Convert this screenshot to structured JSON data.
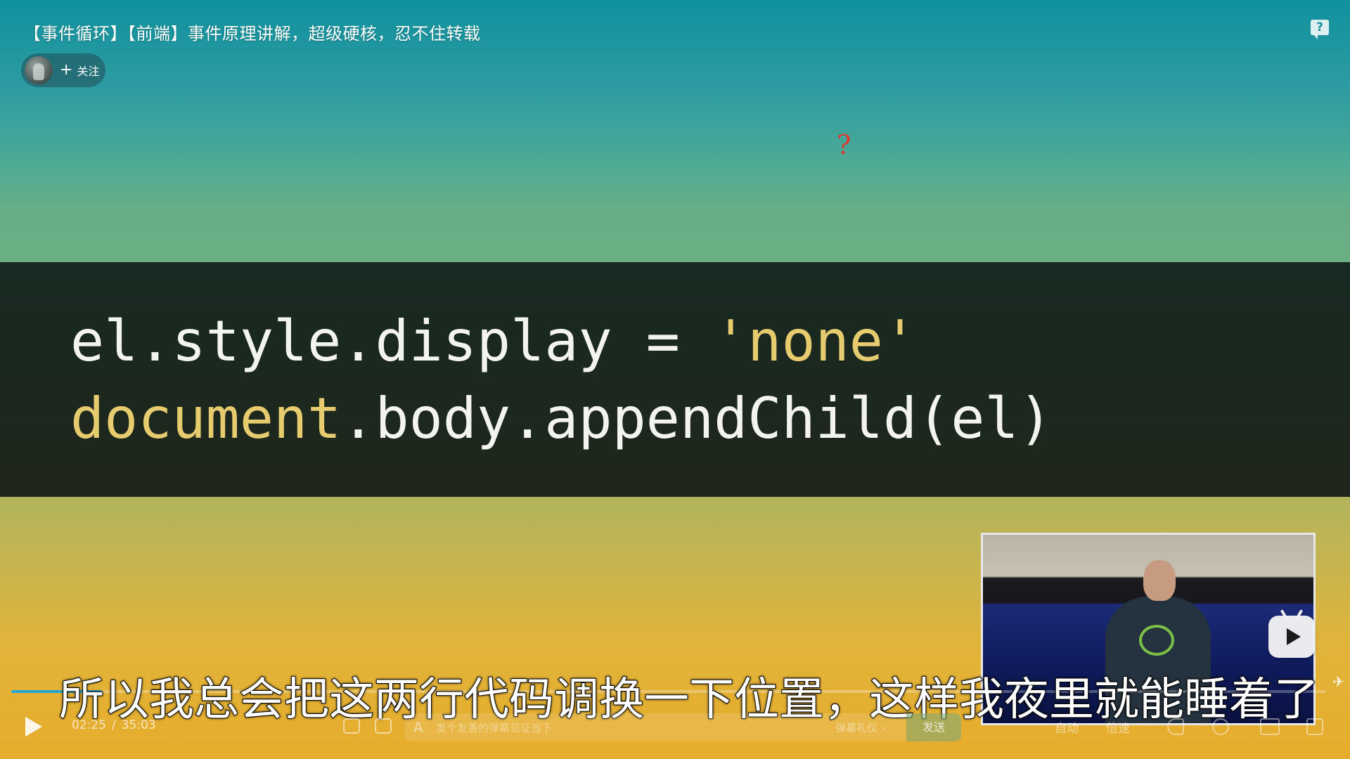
{
  "video": {
    "title": "【事件循环】【前端】事件原理讲解，超级硬核，忍不住转载"
  },
  "uploader": {
    "follow_label": "关注"
  },
  "overlay": {
    "red_mark": "?"
  },
  "slide": {
    "code_lines": [
      {
        "tokens": [
          {
            "text": "el.style.display = ",
            "kind": "plain"
          },
          {
            "text": "'none'",
            "kind": "str"
          }
        ]
      },
      {
        "tokens": [
          {
            "text": "document",
            "kind": "kw"
          },
          {
            "text": ".body.appendChild(el)",
            "kind": "plain"
          }
        ]
      }
    ]
  },
  "subtitle": {
    "text": "所以我总会把这两行代码调换一下位置，这样我夜里就能睡着了"
  },
  "controls": {
    "current_time": "02:25",
    "separator": "/",
    "duration": "35:03",
    "progress_fraction": 0.069,
    "danmaku_placeholder": "发个友善的弹幕见证当下",
    "etiquette_label": "弹幕礼仪 ›",
    "send_label": "发送",
    "quality_label": "自动",
    "speed_label": "倍速"
  },
  "icons": {
    "feedback": "feedback-question-icon",
    "play": "play-icon",
    "danmaku_toggle": "danmaku-toggle-icon",
    "danmaku_settings": "danmaku-settings-icon",
    "danmaku_style": "text-style-icon",
    "volume": "volume-icon",
    "settings": "gear-icon",
    "pip": "picture-in-picture-icon",
    "fullscreen": "fullscreen-icon",
    "pip_play": "bilibili-tv-play-icon"
  },
  "colors": {
    "accent": "#23a6d5",
    "code_string": "#e6cc6e",
    "red_mark": "#e0392f"
  }
}
